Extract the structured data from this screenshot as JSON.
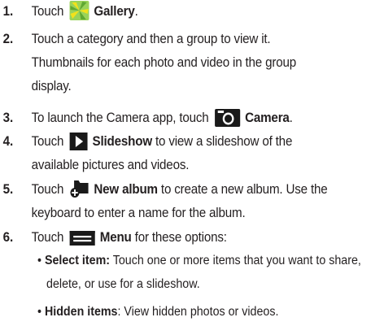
{
  "steps": [
    {
      "number": "1.",
      "lines": [
        {
          "pre": "Touch",
          "bold": "Gallery",
          "post": "."
        }
      ],
      "icon": "gallery-icon"
    },
    {
      "number": "2.",
      "lines": [
        "Touch a category and then a group to view it.",
        "Thumbnails for each photo and video in the group",
        "display."
      ]
    },
    {
      "number": "3.",
      "lines": [
        {
          "pre": "To launch the Camera app, touch",
          "bold": "Camera",
          "post": "."
        }
      ],
      "icon": "camera-icon"
    },
    {
      "number": "4.",
      "lines": [
        {
          "pre": "Touch",
          "bold": "Slideshow",
          "post": " to view a slideshow of the"
        },
        "available pictures and videos."
      ],
      "icon": "slideshow-icon"
    },
    {
      "number": "5.",
      "lines": [
        {
          "pre": "Touch",
          "bold": "New album",
          "post": " to create a new album. Use the"
        },
        "keyboard to enter a name for the album."
      ],
      "icon": "new-album-icon"
    },
    {
      "number": "6.",
      "lines": [
        {
          "pre": "Touch",
          "bold": "Menu",
          "post": " for these options:"
        }
      ],
      "icon": "menu-icon"
    }
  ],
  "bullets": [
    {
      "bold": "Select item:",
      "line1": " Touch one or more items that you want to share,",
      "line2": "delete, or use for a slideshow."
    },
    {
      "bold": "Hidden items",
      "line1": ": View hidden photos or videos."
    }
  ],
  "colors": {
    "text": "#231f20",
    "gallery_green": "#7cc242",
    "gallery_yellow": "#f2e21b",
    "icon_dark": "#1a1a1a"
  }
}
